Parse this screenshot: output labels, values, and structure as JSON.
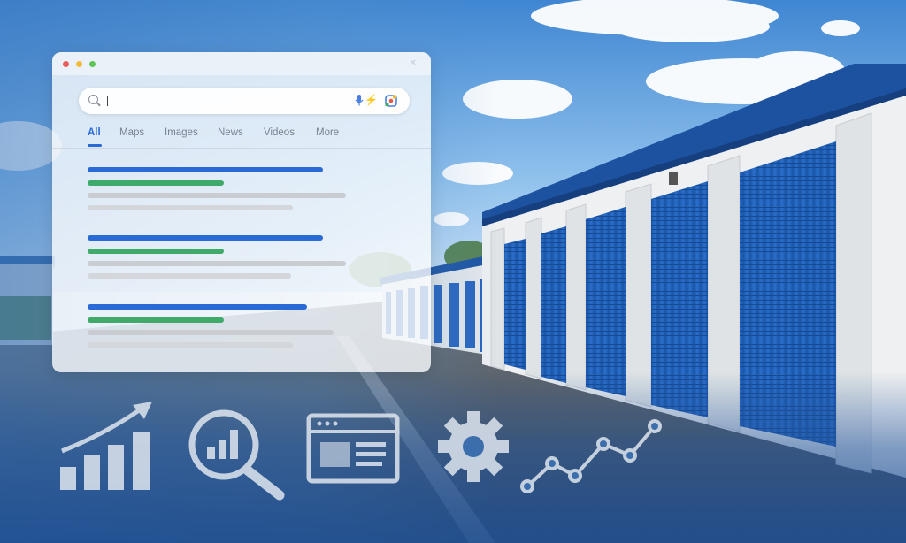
{
  "scene": {
    "description_icons": [
      "storage-building",
      "roll-up-door"
    ],
    "colors": {
      "sky": "#4f93d8",
      "door": "#1e5fb8",
      "roof": "#1c4f9e",
      "wall": "#e9ecee",
      "asphalt": "#4d5660"
    }
  },
  "browser": {
    "window_dots": [
      "#e95f5b",
      "#f2bb3d",
      "#5fc356"
    ],
    "search": {
      "query": "",
      "icons": [
        "search-icon",
        "microphone-icon",
        "sparkle-icon",
        "lens-icon"
      ]
    },
    "tabs": [
      {
        "label": "All",
        "active": true
      },
      {
        "label": "Maps",
        "active": false
      },
      {
        "label": "Images",
        "active": false
      },
      {
        "label": "News",
        "active": false
      },
      {
        "label": "Videos",
        "active": false
      },
      {
        "label": "More",
        "active": false
      }
    ],
    "colors": {
      "title_line": "#2a6ad6",
      "url_line": "#3faa6a",
      "snippet_line": "#c9ccd1"
    },
    "result_count": 3
  },
  "icons": [
    "bar-chart-growth-icon",
    "magnifier-analytics-icon",
    "web-page-icon",
    "gear-icon",
    "trend-line-icon"
  ]
}
